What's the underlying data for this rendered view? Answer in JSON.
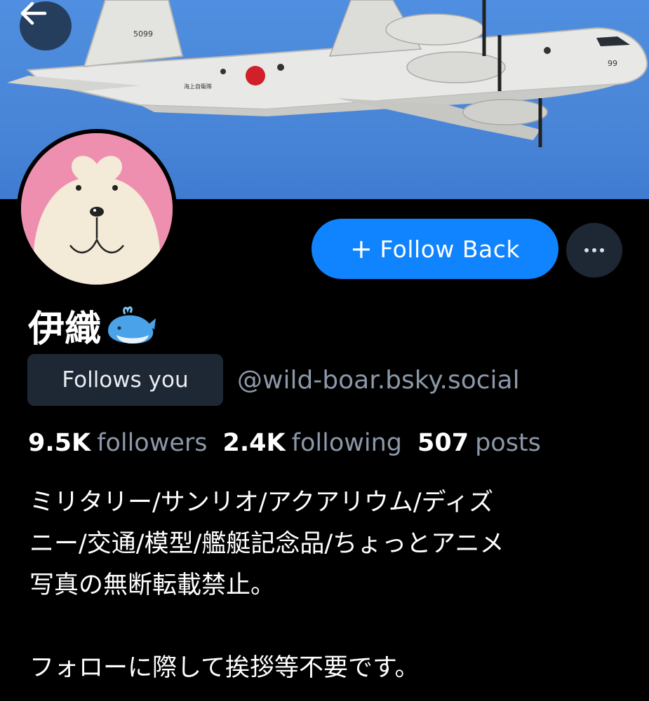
{
  "header": {
    "back_icon": "arrow-left-icon",
    "banner_aircraft_tail_number": "5099",
    "banner_aircraft_nose_number": "99",
    "banner_aircraft_marking": "海上自衛隊"
  },
  "profile": {
    "display_name": "伊織",
    "name_emoji": "🐳",
    "follows_you_label": "Follows you",
    "handle": "@wild-boar.bsky.social"
  },
  "actions": {
    "follow_back_icon": "+",
    "follow_back_label": "Follow Back",
    "more_icon": "more-horizontal-icon"
  },
  "stats": [
    {
      "value": "9.5K",
      "label": "followers"
    },
    {
      "value": "2.4K",
      "label": "following"
    },
    {
      "value": "507",
      "label": "posts"
    }
  ],
  "bio": {
    "line1": "ミリタリー/サンリオ/アクアリウム/ディズ",
    "line2": "ニー/交通/模型/艦艇記念品/ちょっとアニメ",
    "line3": "写真の無断転載禁止。",
    "line4": "フォローに際して挨拶等不要です。"
  },
  "colors": {
    "background": "#000000",
    "accent": "#1083fe",
    "secondary_bg": "#1e2734",
    "muted_text": "#8c98a8",
    "banner_sky": "#4a86d8",
    "avatar_pink": "#ee8fb0"
  }
}
